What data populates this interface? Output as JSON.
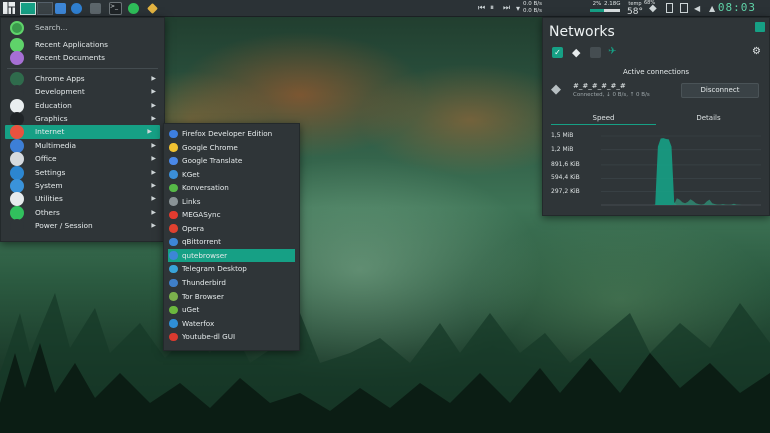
{
  "panel": {
    "net_up": "0.0 B/s",
    "net_down": "0.0 B/s",
    "cpu": "2%",
    "mem": "2.18G",
    "swap": "68%",
    "temp": "58°",
    "temp_label": "temp",
    "clock": "08:03"
  },
  "menu": {
    "search_placeholder": "Search...",
    "top": [
      {
        "label": "Recent Applications",
        "icon": "clock-icon",
        "color": "#5fd36a"
      },
      {
        "label": "Recent Documents",
        "icon": "recent-documents-icon",
        "color": "#a66fd4"
      }
    ],
    "categories": [
      {
        "label": "Chrome Apps",
        "icon": "chrome-apps-icon",
        "color": "#2f6b4c",
        "arrow": "▶"
      },
      {
        "label": "Development",
        "icon": "development-icon",
        "color": "#2f3538",
        "arrow": "▶"
      },
      {
        "label": "Education",
        "icon": "education-icon",
        "color": "#e9eef0",
        "arrow": "▶"
      },
      {
        "label": "Graphics",
        "icon": "graphics-icon",
        "color": "#1f2427",
        "arrow": "▶"
      },
      {
        "label": "Internet",
        "icon": "internet-icon",
        "color": "#e8523f",
        "arrow": "▶"
      },
      {
        "label": "Multimedia",
        "icon": "multimedia-icon",
        "color": "#3d7fd6",
        "arrow": "▶"
      },
      {
        "label": "Office",
        "icon": "office-icon",
        "color": "#d6dade",
        "arrow": "▶"
      },
      {
        "label": "Settings",
        "icon": "settings-icon",
        "color": "#2c86d0",
        "arrow": "▶"
      },
      {
        "label": "System",
        "icon": "system-icon",
        "color": "#3a93da",
        "arrow": "▶"
      },
      {
        "label": "Utilities",
        "icon": "utilities-icon",
        "color": "#e6eaec",
        "arrow": "▶"
      },
      {
        "label": "Others",
        "icon": "others-icon",
        "color": "#31c05d",
        "arrow": "▶"
      },
      {
        "label": "Power / Session",
        "icon": "power-icon",
        "color": "#2f3538",
        "arrow": "▶"
      }
    ]
  },
  "internet": {
    "items": [
      {
        "label": "Firefox Developer Edition",
        "icon": "firefox-dev-icon",
        "color": "#3d7fe0"
      },
      {
        "label": "Google Chrome",
        "icon": "chrome-icon",
        "color": "#f1c232"
      },
      {
        "label": "Google Translate",
        "icon": "translate-icon",
        "color": "#4a88e8"
      },
      {
        "label": "KGet",
        "icon": "kget-icon",
        "color": "#3b8fd8"
      },
      {
        "label": "Konversation",
        "icon": "konversation-icon",
        "color": "#56b947"
      },
      {
        "label": "Links",
        "icon": "links-icon",
        "color": "#8a9396"
      },
      {
        "label": "MEGASync",
        "icon": "megasync-icon",
        "color": "#e23b2f"
      },
      {
        "label": "Opera",
        "icon": "opera-icon",
        "color": "#e0412f"
      },
      {
        "label": "qBittorrent",
        "icon": "qbittorrent-icon",
        "color": "#3d86d6"
      },
      {
        "label": "qutebrowser",
        "icon": "qutebrowser-icon",
        "color": "#3d86d6"
      },
      {
        "label": "Telegram Desktop",
        "icon": "telegram-icon",
        "color": "#39a3d8"
      },
      {
        "label": "Thunderbird",
        "icon": "thunderbird-icon",
        "color": "#3f7fc9"
      },
      {
        "label": "Tor Browser",
        "icon": "tor-icon",
        "color": "#7bb04c"
      },
      {
        "label": "uGet",
        "icon": "uget-icon",
        "color": "#6cb83e"
      },
      {
        "label": "Waterfox",
        "icon": "waterfox-icon",
        "color": "#2f8fd6"
      },
      {
        "label": "Youtube-dl GUI",
        "icon": "youtube-dl-icon",
        "color": "#d93a2f"
      }
    ]
  },
  "networks": {
    "title": "Networks",
    "active_connections": "Active connections",
    "connection_name": "#_#_#_#_#_#",
    "connection_status": "Connected, ↓ 0 B/s, ↑ 0 B/s",
    "disconnect_label": "Disconnect",
    "tabs": [
      "Speed",
      "Details"
    ],
    "accent": "#16a085"
  },
  "chart_data": {
    "type": "area",
    "title": "",
    "xlabel": "",
    "ylabel": "",
    "y_tick_labels": [
      "1,5 MiB",
      "1,2 MiB",
      "891,6 KiB",
      "594,4 KiB",
      "297,2 KiB"
    ],
    "y_ticks_kib": [
      1536,
      1228.8,
      891.6,
      594.4,
      297.2
    ],
    "ylim_kib": [
      0,
      1536
    ],
    "grid": true,
    "series": [
      {
        "values": [
          0,
          0,
          0,
          0,
          0,
          0,
          0,
          0,
          0,
          0,
          0,
          0,
          0,
          0,
          0,
          0,
          0,
          0,
          0,
          0,
          5,
          1300,
          1480,
          1490,
          1470,
          1460,
          1300,
          60,
          0,
          0,
          0,
          0,
          0,
          0,
          0,
          0,
          0,
          0,
          0,
          0,
          0,
          0,
          0,
          0,
          0,
          0,
          0,
          0,
          0,
          0,
          0,
          0,
          0,
          0,
          0,
          0,
          0,
          0,
          0,
          0
        ]
      },
      {
        "values": [
          0,
          0,
          0,
          0,
          0,
          0,
          0,
          0,
          0,
          0,
          0,
          0,
          0,
          0,
          0,
          0,
          0,
          0,
          0,
          0,
          0,
          0,
          0,
          0,
          0,
          0,
          0,
          20,
          150,
          120,
          60,
          40,
          70,
          130,
          90,
          40,
          20,
          10,
          20,
          80,
          120,
          40,
          20,
          10,
          10,
          20,
          10,
          5,
          10,
          30,
          10,
          5,
          0,
          0,
          0,
          0,
          0,
          0,
          0,
          0
        ]
      }
    ]
  }
}
